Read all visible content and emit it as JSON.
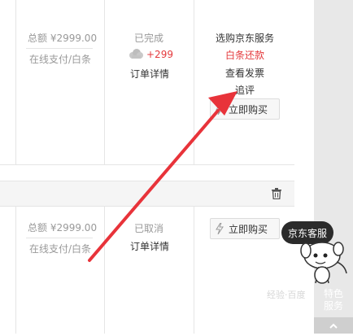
{
  "orders": [
    {
      "amount": "总额 ¥2999.00",
      "payment": "在线支付/白条",
      "status": "已完成",
      "points": "+299",
      "detail_link": "订单详情",
      "actions": [
        "选购京东服务",
        "白条还款",
        "查看发票",
        "追评"
      ],
      "buy_button": "立即购买"
    },
    {
      "amount": "总额 ¥2999.00",
      "payment": "在线支付/白条",
      "status": "已取消",
      "detail_link": "订单详情",
      "buy_button": "立即购买"
    }
  ],
  "customer_service": {
    "bubble": "京东客服",
    "feature_line1": "特色",
    "feature_line2": "服务"
  },
  "watermark": "经验·百度",
  "colors": {
    "accent": "#e4393c",
    "arrow": "#e8333a",
    "rail": "#e8e8e8"
  }
}
